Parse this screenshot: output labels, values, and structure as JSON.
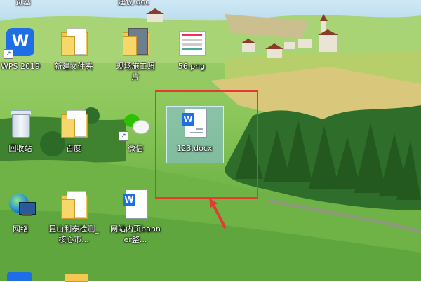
{
  "desktop_icons": [
    {
      "id": "wps",
      "label": "WPS 2019"
    },
    {
      "id": "new-folder",
      "label": "新建文件夹"
    },
    {
      "id": "site-photos",
      "label": "现场施工照片"
    },
    {
      "id": "png",
      "label": "56.png"
    },
    {
      "id": "recycle",
      "label": "回收站"
    },
    {
      "id": "baidu",
      "label": "百度"
    },
    {
      "id": "wechat",
      "label": "微信"
    },
    {
      "id": "docx",
      "label": "123.docx"
    },
    {
      "id": "network",
      "label": "网络"
    },
    {
      "id": "kunshan",
      "label": "昆山利泰检测_核心市..."
    },
    {
      "id": "banner",
      "label": "网站内页banner整..."
    }
  ],
  "cut_labels": {
    "top_left": "览器",
    "top_mid": "建议.doc"
  },
  "annotation": {
    "box_color": "#e53935",
    "arrow_color": "#e53935"
  },
  "colors": {
    "selection": "#87bee1",
    "wps_blue": "#1e6ee6",
    "wechat_green": "#2dc100",
    "folder_yellow": "#f5c851"
  }
}
